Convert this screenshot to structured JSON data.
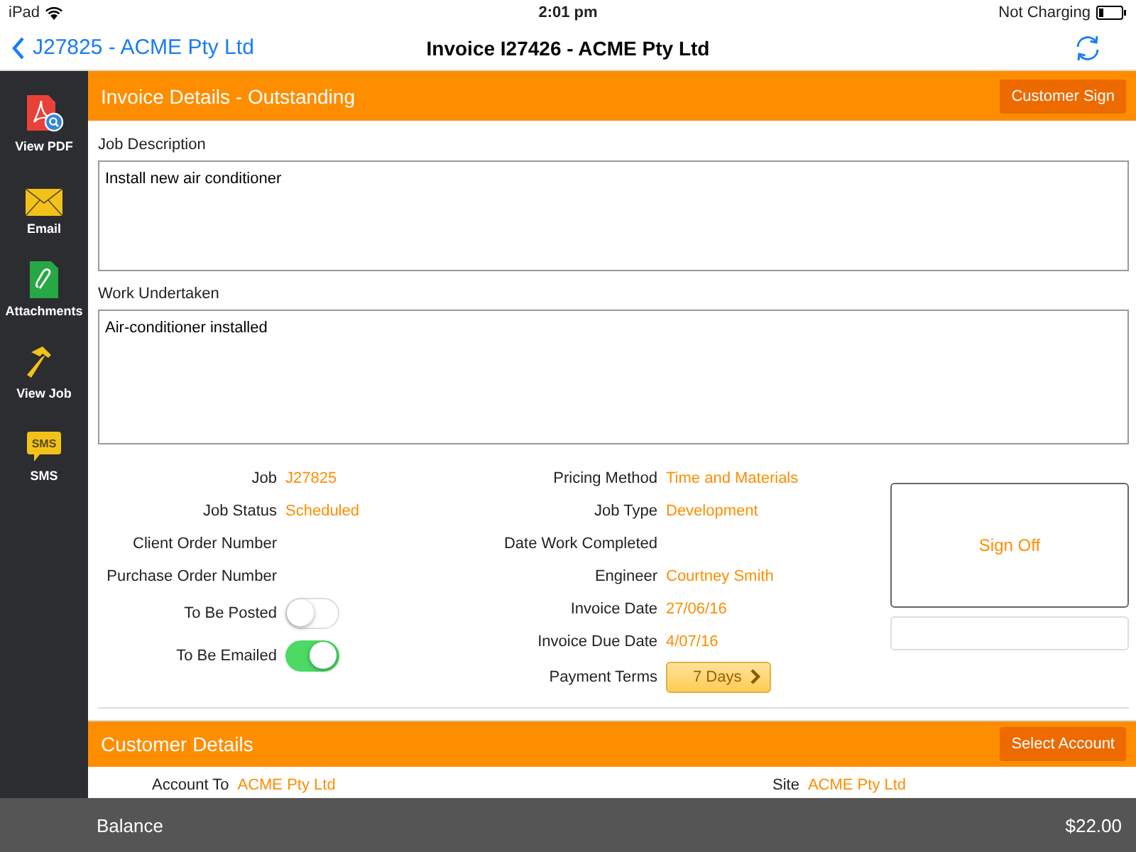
{
  "status_bar": {
    "device": "iPad",
    "time": "2:01 pm",
    "charging": "Not Charging"
  },
  "nav": {
    "back": "J27825 - ACME Pty Ltd",
    "title": "Invoice I27426 - ACME Pty Ltd"
  },
  "sidebar": {
    "items": [
      {
        "kind": "pdf",
        "label": "View PDF"
      },
      {
        "kind": "email",
        "label": "Email"
      },
      {
        "kind": "attachments",
        "label": "Attachments"
      },
      {
        "kind": "job",
        "label": "View Job"
      },
      {
        "kind": "sms",
        "label": "SMS",
        "icon_text": "SMS"
      }
    ]
  },
  "invoice_section": {
    "title": "Invoice Details - Outstanding",
    "button": "Customer Sign"
  },
  "job_description": {
    "label": "Job Description",
    "value": "Install new air conditioner"
  },
  "work_undertaken": {
    "label": "Work Undertaken",
    "value": "Air-conditioner installed"
  },
  "left_fields": [
    {
      "kind": "text",
      "label": "Job",
      "value": "J27825"
    },
    {
      "kind": "text",
      "label": "Job Status",
      "value": "Scheduled"
    },
    {
      "kind": "text",
      "label": "Client Order Number"
    },
    {
      "kind": "text",
      "label": "Purchase Order Number"
    },
    {
      "kind": "toggle",
      "label": "To Be Posted",
      "on": false
    },
    {
      "kind": "toggle",
      "label": "To Be Emailed",
      "on": true
    }
  ],
  "right_fields": [
    {
      "kind": "text",
      "label": "Pricing Method",
      "value": "Time and Materials"
    },
    {
      "kind": "text",
      "label": "Job Type",
      "value": "Development"
    },
    {
      "kind": "text",
      "label": "Date Work Completed"
    },
    {
      "kind": "text",
      "label": "Engineer",
      "value": "Courtney Smith"
    },
    {
      "kind": "text",
      "label": "Invoice Date",
      "value": "27/06/16"
    },
    {
      "kind": "text",
      "label": "Invoice Due Date",
      "value": "4/07/16"
    },
    {
      "kind": "picker",
      "label": "Payment Terms",
      "value": "7 Days"
    }
  ],
  "sign_off": {
    "label": "Sign Off"
  },
  "customer_section": {
    "title": "Customer Details",
    "button": "Select Account",
    "fields": [
      {
        "label": "Account To",
        "value": "ACME Pty Ltd"
      },
      {
        "label": "Site",
        "value": "ACME Pty Ltd"
      }
    ]
  },
  "balance": {
    "label": "Balance",
    "amount": "$22.00"
  }
}
